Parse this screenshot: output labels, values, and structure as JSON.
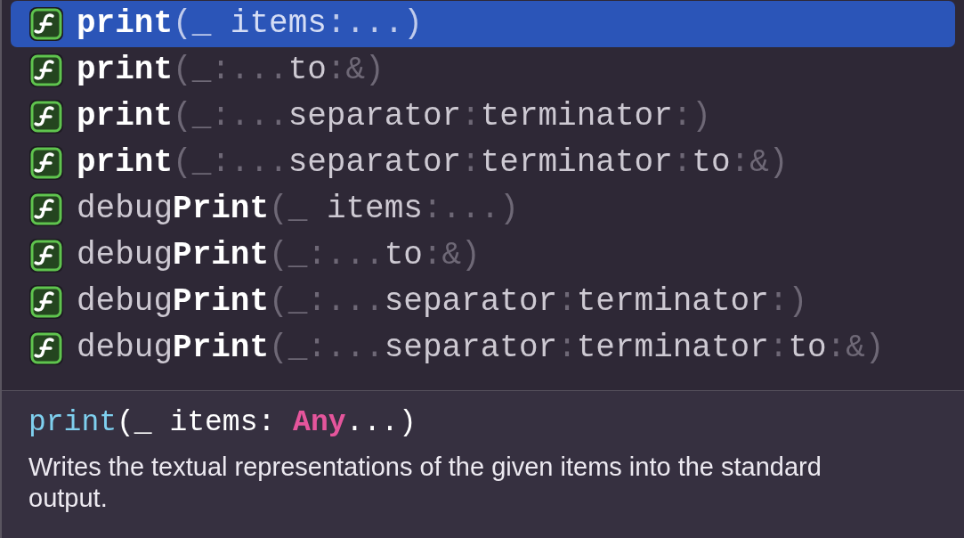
{
  "completions": [
    {
      "selected": true,
      "segments": [
        {
          "kind": "match",
          "text": "print"
        },
        {
          "kind": "punct",
          "text": "(_"
        },
        {
          "kind": "text",
          "text": " items"
        },
        {
          "kind": "punct",
          "text": ":...)"
        }
      ]
    },
    {
      "selected": false,
      "segments": [
        {
          "kind": "match",
          "text": "print"
        },
        {
          "kind": "punct",
          "text": "(_:..."
        },
        {
          "kind": "text",
          "text": "to"
        },
        {
          "kind": "punct",
          "text": ":&)"
        }
      ]
    },
    {
      "selected": false,
      "segments": [
        {
          "kind": "match",
          "text": "print"
        },
        {
          "kind": "punct",
          "text": "(_:..."
        },
        {
          "kind": "text",
          "text": "separator"
        },
        {
          "kind": "punct",
          "text": ":"
        },
        {
          "kind": "text",
          "text": "terminator"
        },
        {
          "kind": "punct",
          "text": ":)"
        }
      ]
    },
    {
      "selected": false,
      "segments": [
        {
          "kind": "match",
          "text": "print"
        },
        {
          "kind": "punct",
          "text": "(_:..."
        },
        {
          "kind": "text",
          "text": "separator"
        },
        {
          "kind": "punct",
          "text": ":"
        },
        {
          "kind": "text",
          "text": "terminator"
        },
        {
          "kind": "punct",
          "text": ":"
        },
        {
          "kind": "text",
          "text": "to"
        },
        {
          "kind": "punct",
          "text": ":&)"
        }
      ]
    },
    {
      "selected": false,
      "segments": [
        {
          "kind": "text",
          "text": "debug"
        },
        {
          "kind": "match",
          "text": "Print"
        },
        {
          "kind": "punct",
          "text": "(_"
        },
        {
          "kind": "text",
          "text": " items"
        },
        {
          "kind": "punct",
          "text": ":...)"
        }
      ]
    },
    {
      "selected": false,
      "segments": [
        {
          "kind": "text",
          "text": "debug"
        },
        {
          "kind": "match",
          "text": "Print"
        },
        {
          "kind": "punct",
          "text": "(_:..."
        },
        {
          "kind": "text",
          "text": "to"
        },
        {
          "kind": "punct",
          "text": ":&)"
        }
      ]
    },
    {
      "selected": false,
      "segments": [
        {
          "kind": "text",
          "text": "debug"
        },
        {
          "kind": "match",
          "text": "Print"
        },
        {
          "kind": "punct",
          "text": "(_:..."
        },
        {
          "kind": "text",
          "text": "separator"
        },
        {
          "kind": "punct",
          "text": ":"
        },
        {
          "kind": "text",
          "text": "terminator"
        },
        {
          "kind": "punct",
          "text": ":)"
        }
      ]
    },
    {
      "selected": false,
      "segments": [
        {
          "kind": "text",
          "text": "debug"
        },
        {
          "kind": "match",
          "text": "Print"
        },
        {
          "kind": "punct",
          "text": "(_:..."
        },
        {
          "kind": "text",
          "text": "separator"
        },
        {
          "kind": "punct",
          "text": ":"
        },
        {
          "kind": "text",
          "text": "terminator"
        },
        {
          "kind": "punct",
          "text": ":"
        },
        {
          "kind": "text",
          "text": "to"
        },
        {
          "kind": "punct",
          "text": ":&)"
        }
      ]
    }
  ],
  "documentation": {
    "signature": [
      {
        "kind": "function",
        "text": "print"
      },
      {
        "kind": "plain",
        "text": "(_ items: "
      },
      {
        "kind": "type",
        "text": "Any"
      },
      {
        "kind": "plain",
        "text": "...)"
      }
    ],
    "summary": "Writes the textual representations of the given items into the standard output."
  }
}
